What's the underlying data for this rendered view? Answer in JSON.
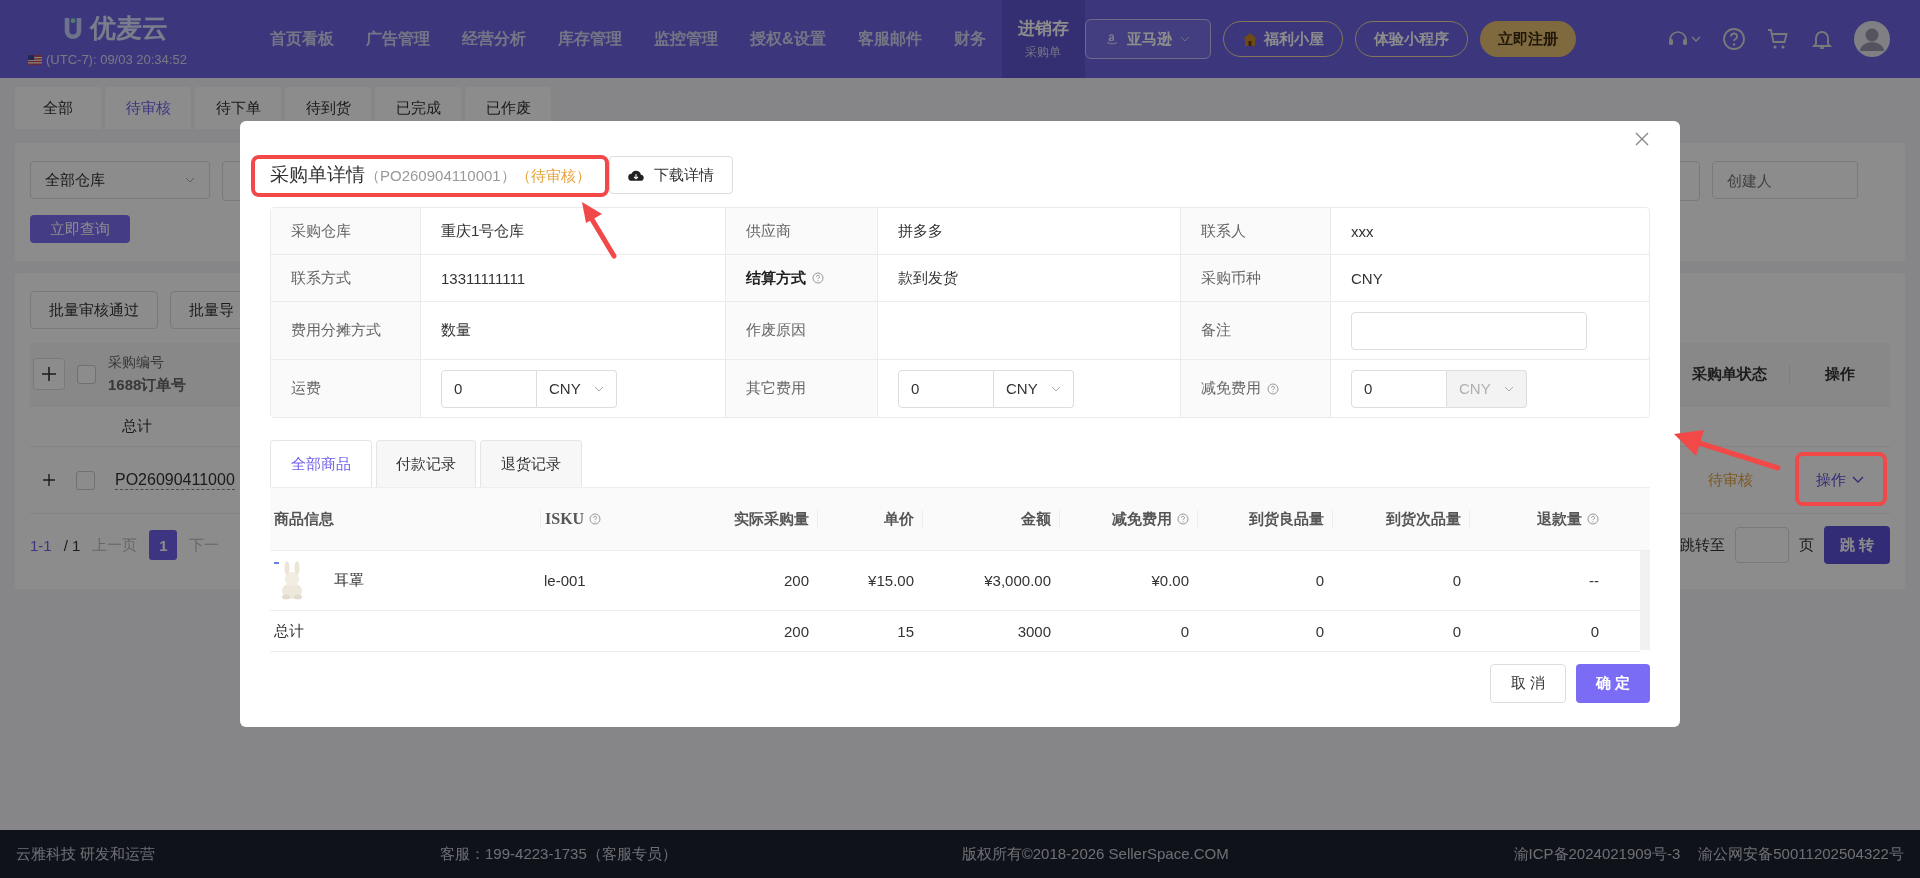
{
  "header": {
    "logo": "优麦云",
    "clock": "(UTC-7): 09/03 20:34:52",
    "nav": [
      {
        "label": "首页看板",
        "selected": false
      },
      {
        "label": "广告管理",
        "selected": false
      },
      {
        "label": "经营分析",
        "selected": false
      },
      {
        "label": "库存管理",
        "selected": false
      },
      {
        "label": "监控管理",
        "selected": false
      },
      {
        "label": "授权&设置",
        "selected": false
      },
      {
        "label": "客服邮件",
        "selected": false
      },
      {
        "label": "财务",
        "selected": false
      },
      {
        "label": "进销存",
        "sub": "采购单",
        "selected": true
      }
    ],
    "marketplace": "亚马逊",
    "buttons": [
      {
        "label": "福利小屋",
        "kind": "gift"
      },
      {
        "label": "体验小程序",
        "kind": "outline"
      },
      {
        "label": "立即注册",
        "kind": "gold"
      }
    ]
  },
  "page": {
    "tabs": [
      {
        "label": "全部",
        "selected": false
      },
      {
        "label": "待审核",
        "selected": true
      },
      {
        "label": "待下单",
        "selected": false
      },
      {
        "label": "待到货",
        "selected": false
      },
      {
        "label": "已完成",
        "selected": false
      },
      {
        "label": "已作废",
        "selected": false
      }
    ],
    "filters": {
      "warehouse": "全部仓库",
      "creator_placeholder": "创建人",
      "search_button": "立即查询"
    },
    "actions": [
      "批量审核通过",
      "批量导"
    ],
    "table": {
      "id_header": [
        "采购编号",
        "1688订单号"
      ],
      "status_header": "采购单状态",
      "action_header": "操作",
      "total_label": "总计",
      "rows": [
        {
          "id": "PO26090411000",
          "status": "待审核",
          "action": "操作",
          "checked": false
        }
      ]
    },
    "pagination": {
      "range": "1-1",
      "total": "/ 1",
      "prev": "上一页",
      "pages": [
        {
          "label": "1",
          "selected": true
        }
      ],
      "next": "下一",
      "goto": "跳转至",
      "page_unit": "页",
      "jump": "跳 转"
    }
  },
  "modal": {
    "title": "采购单详情",
    "number": "（PO260904110001）",
    "status": "（待审核）",
    "download": "下载详情",
    "fields": [
      {
        "label": "采购仓库",
        "help": false,
        "strong": false,
        "kind": "text",
        "value": "重庆1号仓库"
      },
      {
        "label": "供应商",
        "help": false,
        "strong": false,
        "kind": "text",
        "value": "拼多多"
      },
      {
        "label": "联系人",
        "help": false,
        "strong": false,
        "kind": "text",
        "value": "xxx"
      },
      {
        "label": "联系方式",
        "help": false,
        "strong": false,
        "kind": "text",
        "value": "13311111111"
      },
      {
        "label": "结算方式",
        "help": true,
        "strong": true,
        "kind": "text",
        "value": "款到发货"
      },
      {
        "label": "采购币种",
        "help": false,
        "strong": false,
        "kind": "text",
        "value": "CNY"
      },
      {
        "label": "费用分摊方式",
        "help": false,
        "strong": false,
        "kind": "text",
        "value": "数量"
      },
      {
        "label": "作废原因",
        "help": false,
        "strong": false,
        "kind": "blank"
      },
      {
        "label": "备注",
        "help": false,
        "strong": false,
        "kind": "input"
      },
      {
        "label": "运费",
        "help": false,
        "strong": false,
        "kind": "money",
        "value": "0",
        "currency": "CNY",
        "disabled": false
      },
      {
        "label": "其它费用",
        "help": false,
        "strong": false,
        "kind": "money",
        "value": "0",
        "currency": "CNY",
        "disabled": false
      },
      {
        "label": "减免费用",
        "help": true,
        "strong": false,
        "kind": "money",
        "value": "0",
        "currency": "CNY",
        "disabled": true
      }
    ],
    "tabs": [
      {
        "label": "全部商品",
        "selected": true
      },
      {
        "label": "付款记录",
        "selected": false
      },
      {
        "label": "退货记录",
        "selected": false
      }
    ],
    "columns": [
      {
        "label": "商品信息",
        "help": false
      },
      {
        "label": "ISKU",
        "help": true
      },
      {
        "label": "实际采购量",
        "help": false
      },
      {
        "label": "单价",
        "help": false
      },
      {
        "label": "金额",
        "help": false
      },
      {
        "label": "减免费用",
        "help": true
      },
      {
        "label": "到货良品量",
        "help": false
      },
      {
        "label": "到货次品量",
        "help": false
      },
      {
        "label": "退款量",
        "help": true
      }
    ],
    "product": {
      "kind": "picture",
      "name": "耳罩",
      "isku": "le-001",
      "values": [
        "200",
        "¥15.00",
        "¥3,000.00",
        "¥0.00",
        "0",
        "0",
        "--"
      ]
    },
    "total": {
      "label": "总计",
      "values": [
        "200",
        "15",
        "3000",
        "0",
        "0",
        "0",
        "0"
      ]
    },
    "cancel": "取 消",
    "ok": "确 定"
  },
  "footer": {
    "company": "云雅科技 研发和运营",
    "service": "客服：199-4223-1735（客服专员）",
    "copyright": "版权所有©2018-2026 SellerSpace.COM",
    "icp": "渝ICP备2024021909号-3",
    "police": "渝公网安备50011202504322号"
  }
}
